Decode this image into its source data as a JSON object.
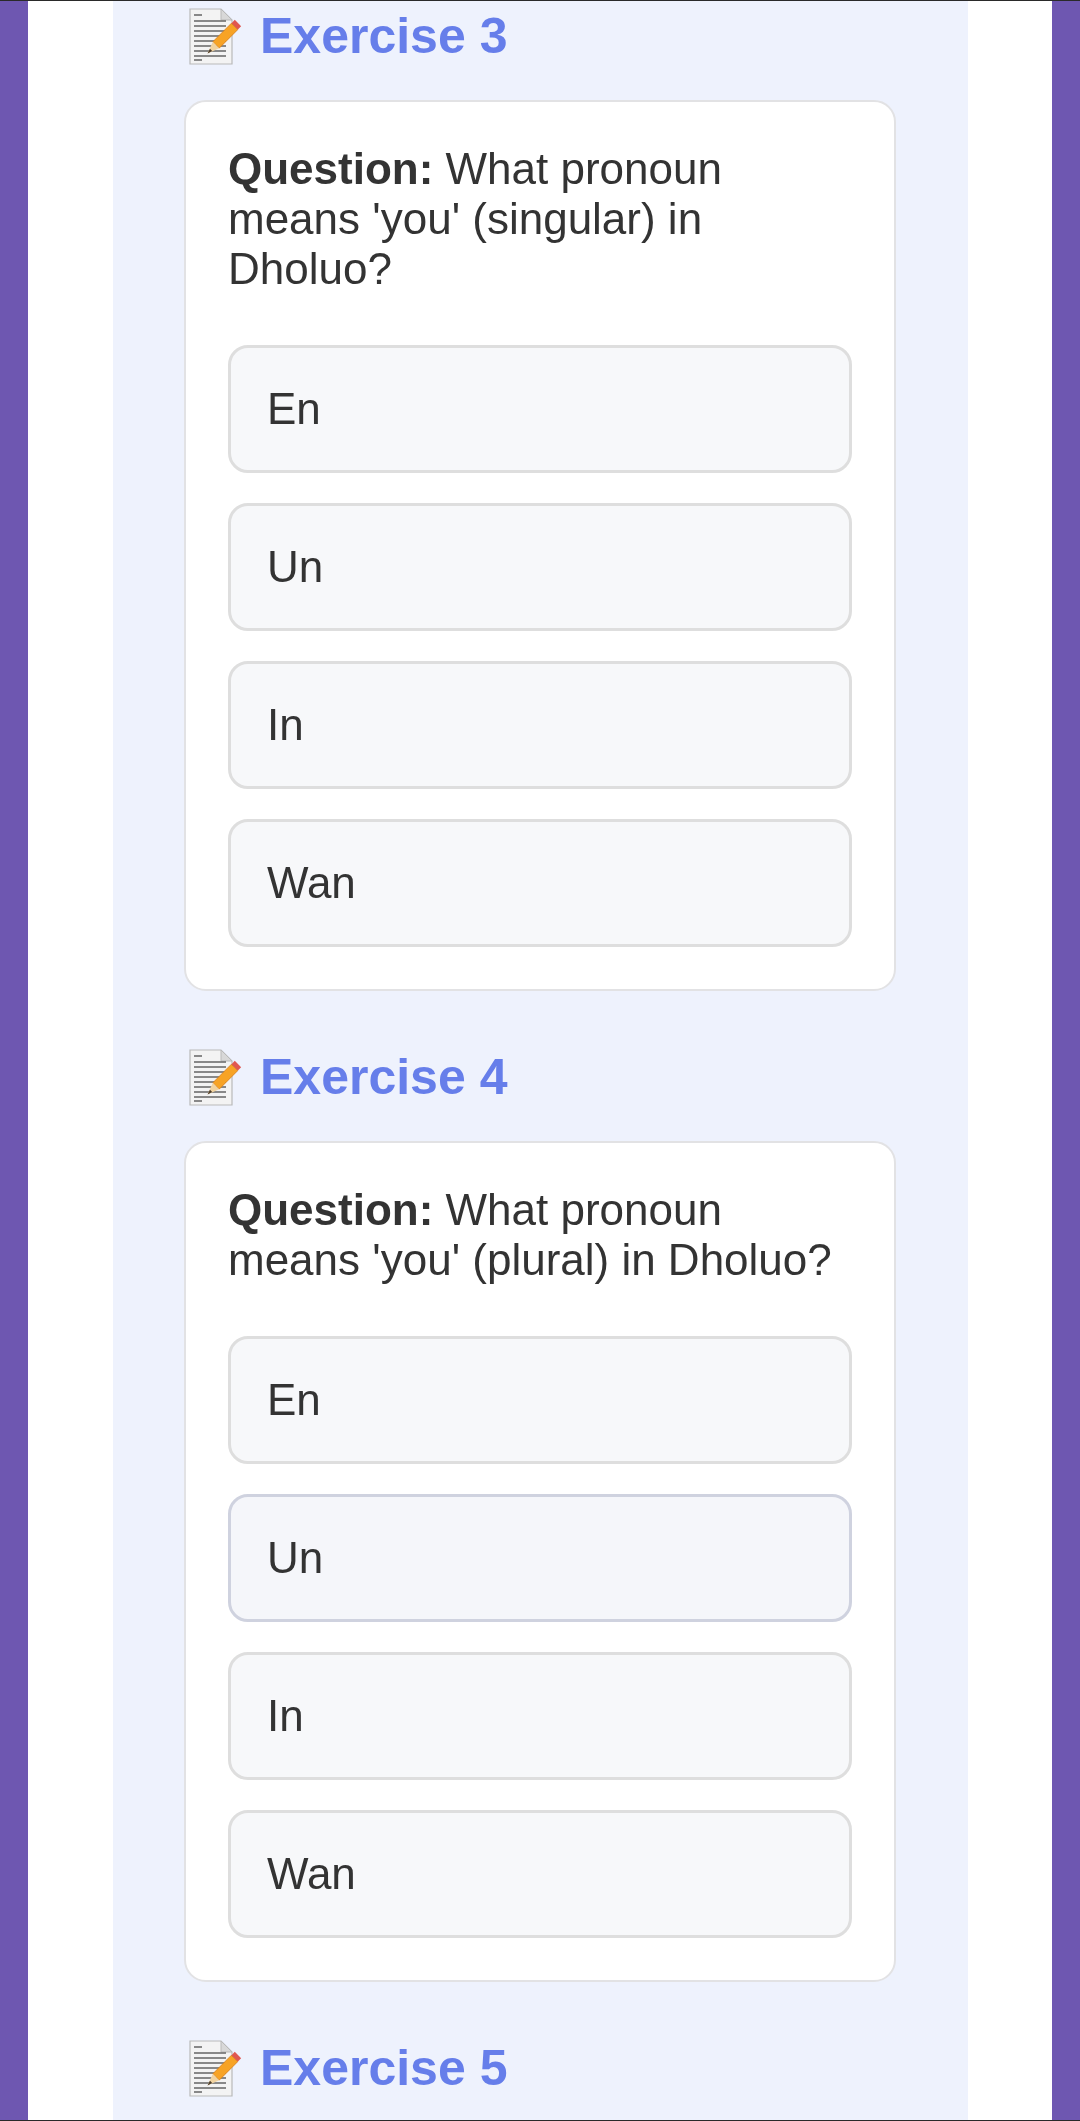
{
  "exercises": [
    {
      "title": "Exercise 3",
      "question": "**Question:** What pronoun means 'you' (singular) in Dholuo?",
      "options": [
        {
          "label": "En",
          "selected": false
        },
        {
          "label": "Un",
          "selected": false
        },
        {
          "label": "In",
          "selected": false
        },
        {
          "label": "Wan",
          "selected": false
        }
      ]
    },
    {
      "title": "Exercise 4",
      "question": "**Question:** What pronoun means 'you' (plural) in Dholuo?",
      "options": [
        {
          "label": "En",
          "selected": false
        },
        {
          "label": "Un",
          "selected": true
        },
        {
          "label": "In",
          "selected": false
        },
        {
          "label": "Wan",
          "selected": false
        }
      ]
    },
    {
      "title": "Exercise 5"
    }
  ]
}
